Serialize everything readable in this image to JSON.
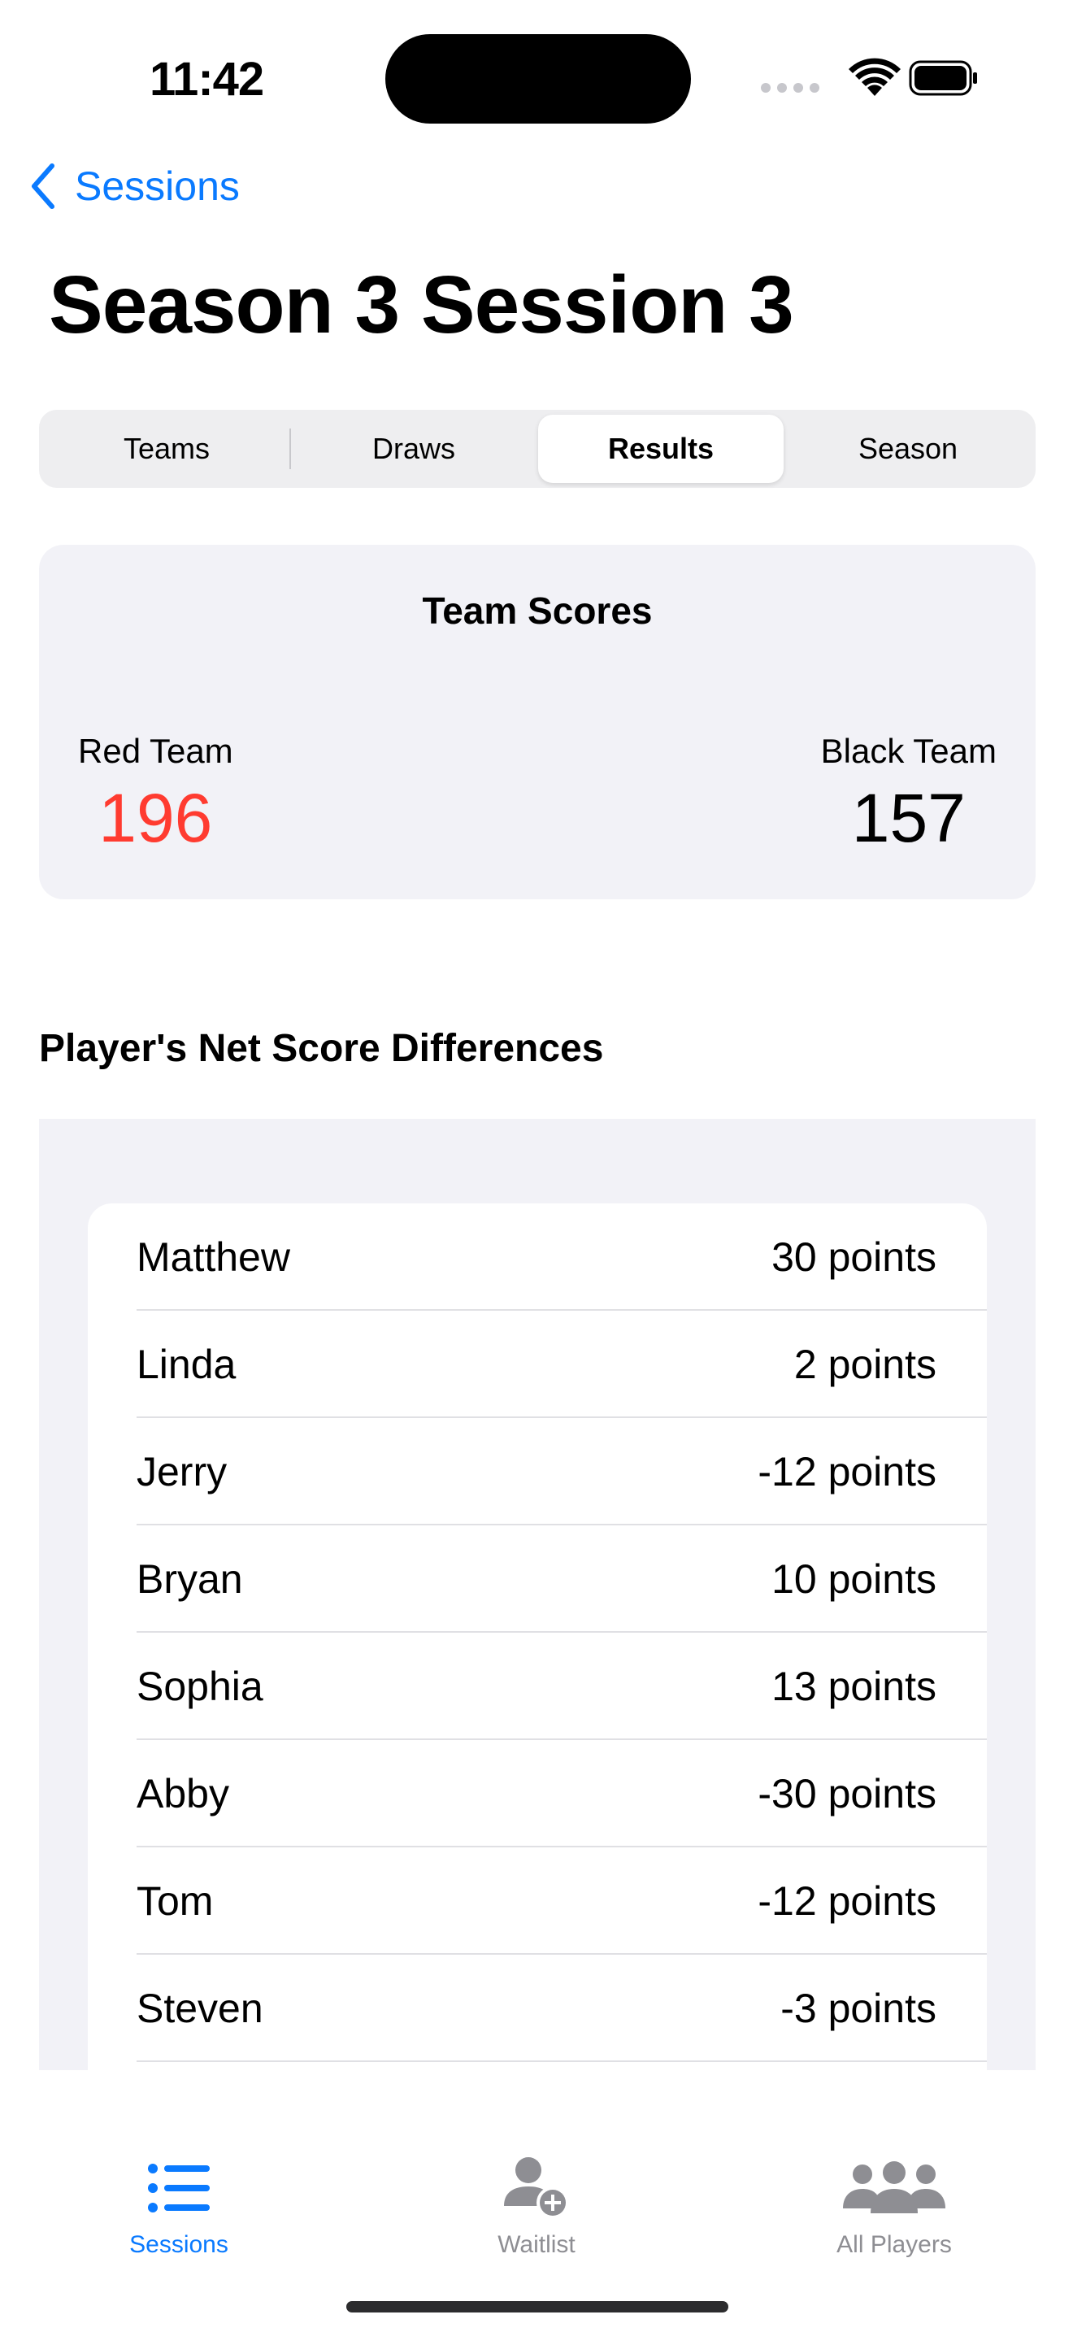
{
  "status": {
    "time": "11:42"
  },
  "nav": {
    "back_label": "Sessions",
    "title": "Season 3 Session 3"
  },
  "segments": [
    {
      "label": "Teams",
      "selected": false
    },
    {
      "label": "Draws",
      "selected": false
    },
    {
      "label": "Results",
      "selected": true
    },
    {
      "label": "Season",
      "selected": false
    }
  ],
  "team_scores": {
    "title": "Team Scores",
    "red": {
      "name": "Red Team",
      "score": "196",
      "color": "#ff3b30"
    },
    "black": {
      "name": "Black Team",
      "score": "157"
    }
  },
  "net_section": {
    "title": "Player's Net Score Differences"
  },
  "players": [
    {
      "name": "Matthew",
      "value": "30 points"
    },
    {
      "name": "Linda",
      "value": "2 points"
    },
    {
      "name": "Jerry",
      "value": "-12 points"
    },
    {
      "name": "Bryan",
      "value": "10 points"
    },
    {
      "name": "Sophia",
      "value": "13 points"
    },
    {
      "name": "Abby",
      "value": "-30 points"
    },
    {
      "name": "Tom",
      "value": "-12 points"
    },
    {
      "name": "Steven",
      "value": "-3 points"
    }
  ],
  "tabbar": {
    "items": [
      {
        "label": "Sessions",
        "icon": "list-icon",
        "active": true
      },
      {
        "label": "Waitlist",
        "icon": "person-add-icon",
        "active": false
      },
      {
        "label": "All Players",
        "icon": "people-icon",
        "active": false
      }
    ]
  },
  "colors": {
    "accent": "#0a7aff",
    "red": "#ff3b30",
    "card_bg": "#f2f2f7"
  }
}
